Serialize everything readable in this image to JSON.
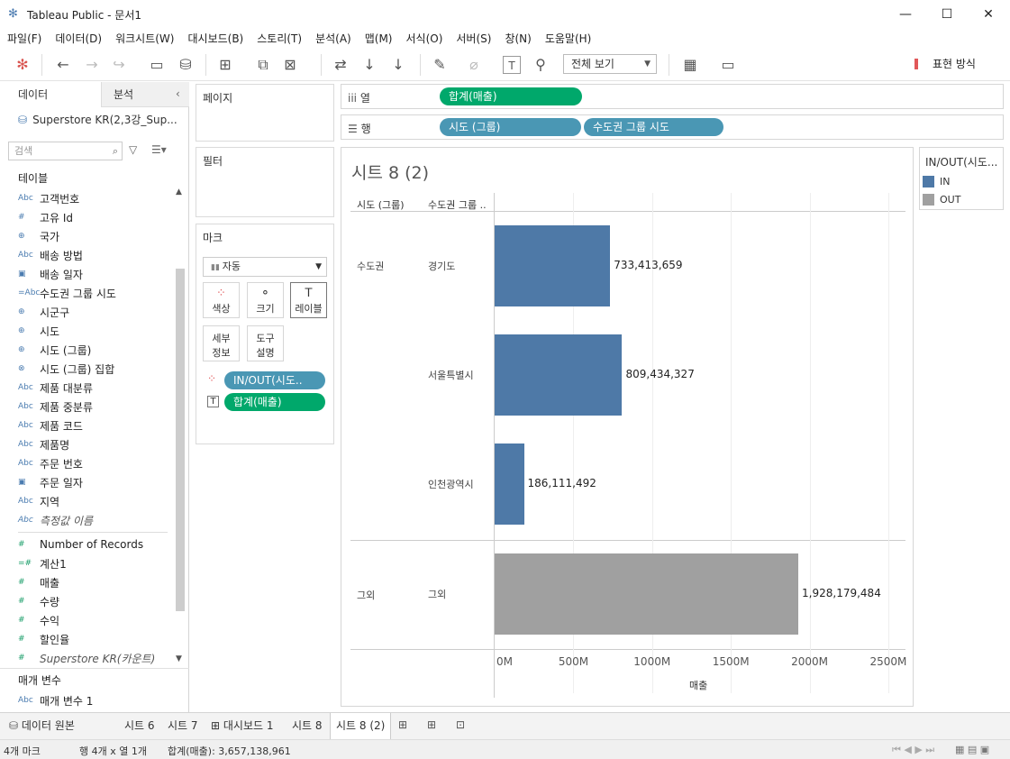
{
  "window": {
    "title": "Tableau Public - 문서1",
    "minimize": "—",
    "maximize": "☐",
    "close": "✕"
  },
  "menu": [
    "파일(F)",
    "데이터(D)",
    "워크시트(W)",
    "대시보드(B)",
    "스토리(T)",
    "분석(A)",
    "맵(M)",
    "서식(O)",
    "서버(S)",
    "창(N)",
    "도움말(H)"
  ],
  "toolbar": {
    "view_mode": "전체 보기",
    "show_me": "표현 방식"
  },
  "data_pane": {
    "tab_data": "데이터",
    "tab_analysis": "분석",
    "datasource": "Superstore KR(2,3강_Sup...",
    "search_placeholder": "검색",
    "tables_title": "테이블",
    "dimensions": [
      {
        "icon": "Abc",
        "label": "고객번호"
      },
      {
        "icon": "#",
        "label": "고유 Id"
      },
      {
        "icon": "⊕",
        "label": "국가"
      },
      {
        "icon": "Abc",
        "label": "배송 방법"
      },
      {
        "icon": "▣",
        "label": "배송 일자"
      },
      {
        "icon": "=Abc",
        "label": "수도권 그룹 시도"
      },
      {
        "icon": "⊕",
        "label": "시군구"
      },
      {
        "icon": "⊕",
        "label": "시도"
      },
      {
        "icon": "⊕",
        "label": "시도 (그룹)"
      },
      {
        "icon": "⊗",
        "label": "시도 (그룹) 집합"
      },
      {
        "icon": "Abc",
        "label": "제품 대분류"
      },
      {
        "icon": "Abc",
        "label": "제품 중분류"
      },
      {
        "icon": "Abc",
        "label": "제품 코드"
      },
      {
        "icon": "Abc",
        "label": "제품명"
      },
      {
        "icon": "Abc",
        "label": "주문 번호"
      },
      {
        "icon": "▣",
        "label": "주문 일자"
      },
      {
        "icon": "Abc",
        "label": "지역"
      },
      {
        "icon": "Abc",
        "label": "측정값 이름"
      }
    ],
    "measures": [
      {
        "icon": "#",
        "label": "Number of Records"
      },
      {
        "icon": "=#",
        "label": "계산1"
      },
      {
        "icon": "#",
        "label": "매출"
      },
      {
        "icon": "#",
        "label": "수량"
      },
      {
        "icon": "#",
        "label": "수익"
      },
      {
        "icon": "#",
        "label": "할인율"
      },
      {
        "icon": "#",
        "label": "Superstore KR(카운트)"
      }
    ],
    "params_title": "매개 변수",
    "params": [
      {
        "icon": "Abc",
        "label": "매개 변수 1"
      }
    ]
  },
  "cards": {
    "pages": "페이지",
    "filters": "필터",
    "marks": "마크",
    "mark_type": "자동",
    "btn_color": "색상",
    "btn_size": "크기",
    "btn_label": "레이블",
    "btn_detail": [
      "세부",
      "정보"
    ],
    "btn_tooltip": [
      "도구",
      "설명"
    ],
    "mark_pills": [
      "IN/OUT(시도..",
      "합계(매출)"
    ]
  },
  "shelves": {
    "columns_label": "열",
    "rows_label": "행",
    "columns_pills": [
      "합계(매출)"
    ],
    "rows_pills": [
      "시도 (그룹)",
      "수도권 그룹 시도"
    ]
  },
  "worksheet": {
    "title": "시트 8 (2)",
    "header_col1": "시도 (그룹)",
    "header_col2": "수도권 그룹 ..",
    "group1": "수도권",
    "group2": "그외"
  },
  "chart_data": {
    "type": "bar",
    "orientation": "horizontal",
    "categories": [
      "경기도",
      "서울특별시",
      "인천광역시",
      "그외"
    ],
    "groups": [
      "수도권",
      "수도권",
      "수도권",
      "그외"
    ],
    "values": [
      733413659,
      809434327,
      186111492,
      1928179484
    ],
    "labels": [
      "733,413,659",
      "809,434,327",
      "186,111,492",
      "1,928,179,484"
    ],
    "color_group": [
      "IN",
      "IN",
      "IN",
      "OUT"
    ],
    "xlabel": "매출",
    "xlim": [
      0,
      2500000000
    ],
    "ticks": [
      "0M",
      "500M",
      "1000M",
      "1500M",
      "2000M",
      "2500M"
    ],
    "grid": true
  },
  "legend": {
    "title": "IN/OUT(시도...",
    "items": [
      {
        "label": "IN",
        "color": "#4e79a7"
      },
      {
        "label": "OUT",
        "color": "#a0a0a0"
      }
    ]
  },
  "bottom_tabs": [
    "데이터 원본",
    "시트 6",
    "시트 7",
    "대시보드 1",
    "시트 8",
    "시트 8 (2)"
  ],
  "status": {
    "marks": "4개 마크",
    "rows_cols": "행 4개  x  열 1개",
    "sum": "합계(매출): 3,657,138,961"
  }
}
